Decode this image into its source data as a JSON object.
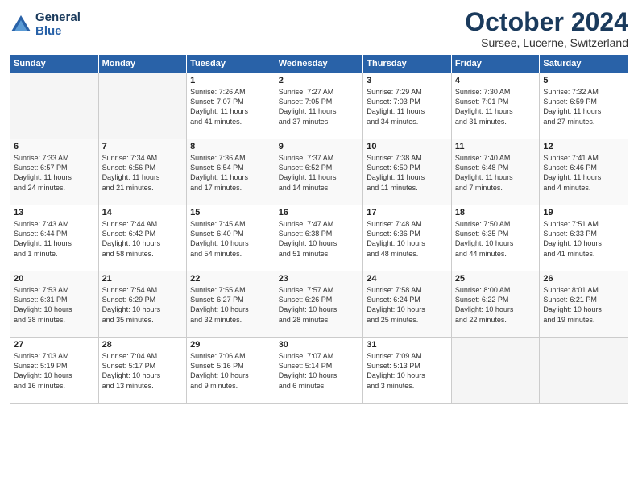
{
  "header": {
    "logo_line1": "General",
    "logo_line2": "Blue",
    "month": "October 2024",
    "location": "Sursee, Lucerne, Switzerland"
  },
  "weekdays": [
    "Sunday",
    "Monday",
    "Tuesday",
    "Wednesday",
    "Thursday",
    "Friday",
    "Saturday"
  ],
  "weeks": [
    [
      {
        "day": "",
        "info": ""
      },
      {
        "day": "",
        "info": ""
      },
      {
        "day": "1",
        "info": "Sunrise: 7:26 AM\nSunset: 7:07 PM\nDaylight: 11 hours\nand 41 minutes."
      },
      {
        "day": "2",
        "info": "Sunrise: 7:27 AM\nSunset: 7:05 PM\nDaylight: 11 hours\nand 37 minutes."
      },
      {
        "day": "3",
        "info": "Sunrise: 7:29 AM\nSunset: 7:03 PM\nDaylight: 11 hours\nand 34 minutes."
      },
      {
        "day": "4",
        "info": "Sunrise: 7:30 AM\nSunset: 7:01 PM\nDaylight: 11 hours\nand 31 minutes."
      },
      {
        "day": "5",
        "info": "Sunrise: 7:32 AM\nSunset: 6:59 PM\nDaylight: 11 hours\nand 27 minutes."
      }
    ],
    [
      {
        "day": "6",
        "info": "Sunrise: 7:33 AM\nSunset: 6:57 PM\nDaylight: 11 hours\nand 24 minutes."
      },
      {
        "day": "7",
        "info": "Sunrise: 7:34 AM\nSunset: 6:56 PM\nDaylight: 11 hours\nand 21 minutes."
      },
      {
        "day": "8",
        "info": "Sunrise: 7:36 AM\nSunset: 6:54 PM\nDaylight: 11 hours\nand 17 minutes."
      },
      {
        "day": "9",
        "info": "Sunrise: 7:37 AM\nSunset: 6:52 PM\nDaylight: 11 hours\nand 14 minutes."
      },
      {
        "day": "10",
        "info": "Sunrise: 7:38 AM\nSunset: 6:50 PM\nDaylight: 11 hours\nand 11 minutes."
      },
      {
        "day": "11",
        "info": "Sunrise: 7:40 AM\nSunset: 6:48 PM\nDaylight: 11 hours\nand 7 minutes."
      },
      {
        "day": "12",
        "info": "Sunrise: 7:41 AM\nSunset: 6:46 PM\nDaylight: 11 hours\nand 4 minutes."
      }
    ],
    [
      {
        "day": "13",
        "info": "Sunrise: 7:43 AM\nSunset: 6:44 PM\nDaylight: 11 hours\nand 1 minute."
      },
      {
        "day": "14",
        "info": "Sunrise: 7:44 AM\nSunset: 6:42 PM\nDaylight: 10 hours\nand 58 minutes."
      },
      {
        "day": "15",
        "info": "Sunrise: 7:45 AM\nSunset: 6:40 PM\nDaylight: 10 hours\nand 54 minutes."
      },
      {
        "day": "16",
        "info": "Sunrise: 7:47 AM\nSunset: 6:38 PM\nDaylight: 10 hours\nand 51 minutes."
      },
      {
        "day": "17",
        "info": "Sunrise: 7:48 AM\nSunset: 6:36 PM\nDaylight: 10 hours\nand 48 minutes."
      },
      {
        "day": "18",
        "info": "Sunrise: 7:50 AM\nSunset: 6:35 PM\nDaylight: 10 hours\nand 44 minutes."
      },
      {
        "day": "19",
        "info": "Sunrise: 7:51 AM\nSunset: 6:33 PM\nDaylight: 10 hours\nand 41 minutes."
      }
    ],
    [
      {
        "day": "20",
        "info": "Sunrise: 7:53 AM\nSunset: 6:31 PM\nDaylight: 10 hours\nand 38 minutes."
      },
      {
        "day": "21",
        "info": "Sunrise: 7:54 AM\nSunset: 6:29 PM\nDaylight: 10 hours\nand 35 minutes."
      },
      {
        "day": "22",
        "info": "Sunrise: 7:55 AM\nSunset: 6:27 PM\nDaylight: 10 hours\nand 32 minutes."
      },
      {
        "day": "23",
        "info": "Sunrise: 7:57 AM\nSunset: 6:26 PM\nDaylight: 10 hours\nand 28 minutes."
      },
      {
        "day": "24",
        "info": "Sunrise: 7:58 AM\nSunset: 6:24 PM\nDaylight: 10 hours\nand 25 minutes."
      },
      {
        "day": "25",
        "info": "Sunrise: 8:00 AM\nSunset: 6:22 PM\nDaylight: 10 hours\nand 22 minutes."
      },
      {
        "day": "26",
        "info": "Sunrise: 8:01 AM\nSunset: 6:21 PM\nDaylight: 10 hours\nand 19 minutes."
      }
    ],
    [
      {
        "day": "27",
        "info": "Sunrise: 7:03 AM\nSunset: 5:19 PM\nDaylight: 10 hours\nand 16 minutes."
      },
      {
        "day": "28",
        "info": "Sunrise: 7:04 AM\nSunset: 5:17 PM\nDaylight: 10 hours\nand 13 minutes."
      },
      {
        "day": "29",
        "info": "Sunrise: 7:06 AM\nSunset: 5:16 PM\nDaylight: 10 hours\nand 9 minutes."
      },
      {
        "day": "30",
        "info": "Sunrise: 7:07 AM\nSunset: 5:14 PM\nDaylight: 10 hours\nand 6 minutes."
      },
      {
        "day": "31",
        "info": "Sunrise: 7:09 AM\nSunset: 5:13 PM\nDaylight: 10 hours\nand 3 minutes."
      },
      {
        "day": "",
        "info": ""
      },
      {
        "day": "",
        "info": ""
      }
    ]
  ]
}
